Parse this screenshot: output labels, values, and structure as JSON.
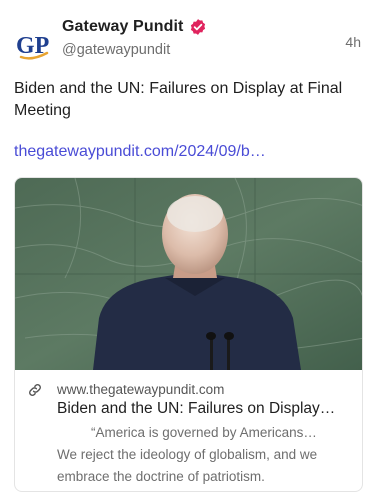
{
  "author": {
    "name": "Gateway Pundit",
    "handle": "@gatewaypundit",
    "avatar_text": "GP",
    "verified": true
  },
  "time": "4h",
  "post": {
    "text": "Biden and the UN: Failures on Display at Final Meeting",
    "link": "thegatewaypundit.com/2024/09/b…"
  },
  "card": {
    "domain": "www.thegatewaypundit.com",
    "title": "Biden and the UN: Failures on Display…",
    "description_lead": "“America is governed by Americans…",
    "description_rest": "We reject the ideology of globalism, and we embrace the doctrine of patriotism."
  },
  "colors": {
    "link": "#4a4cd6",
    "verified_badge": "#e0245e",
    "avatar_blue": "#1f3f8f",
    "avatar_swoosh": "#e8a431"
  },
  "icons": {
    "verified": "verified-badge-icon",
    "link": "link-icon"
  }
}
